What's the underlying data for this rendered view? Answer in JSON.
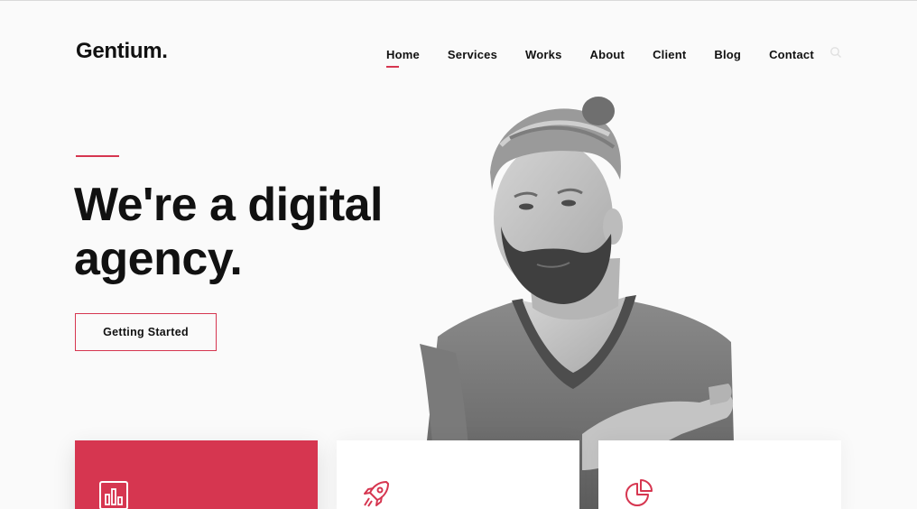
{
  "header": {
    "logo": "Gentium.",
    "nav": [
      "Home",
      "Services",
      "Works",
      "About",
      "Client",
      "Blog",
      "Contact"
    ],
    "active_nav": "Home"
  },
  "hero": {
    "headline_line1": "We're a digital",
    "headline_line2": "agency.",
    "cta_label": "Getting Started"
  },
  "cards": [
    {
      "icon": "bar-chart-icon",
      "style": "accent"
    },
    {
      "icon": "rocket-icon",
      "style": "plain"
    },
    {
      "icon": "pie-chart-icon",
      "style": "plain"
    }
  ],
  "colors": {
    "accent": "#d63650",
    "text": "#111111",
    "background": "#fafafa"
  }
}
